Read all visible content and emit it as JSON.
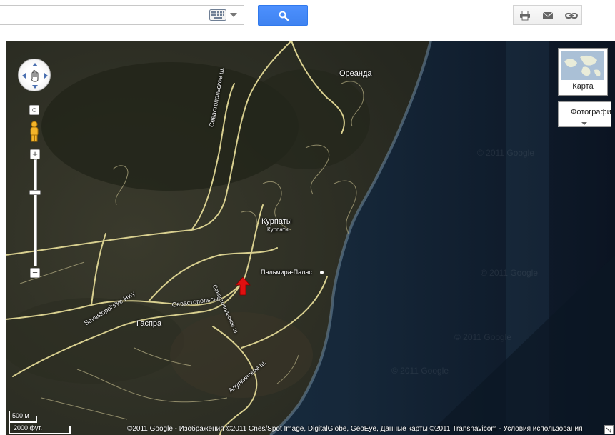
{
  "search": {
    "value": "",
    "placeholder": ""
  },
  "icons": {
    "keyboard": "keyboard-icon",
    "search": "search-icon",
    "print": "print-icon",
    "email": "email-icon",
    "link": "link-icon",
    "pan": "pan-arrows-icon",
    "pegman": "pegman-icon",
    "marker": "red-arrow-marker-icon"
  },
  "colors": {
    "search_button": "#4d90fe",
    "sea": "#15283a",
    "land": "#2f3125",
    "roads": "#d8cf8f",
    "marker": "#e01010"
  },
  "map": {
    "mode": "satellite",
    "labels": {
      "oreanda": "Ореанда",
      "kurpaty": "Курпаты",
      "kurpaty_small": "Курпати",
      "palmira": "Пальмира-Палас",
      "gaspra": "Гаспра",
      "sevastopol_road_north": "Севастопольское ш.",
      "sevastopol_road_center": "Севастопольское ш.",
      "sevastopol_road_mid": "Севастопольськ",
      "sevastopol_hwy": "Sevastopol's'ke Hwy",
      "alupka_road": "Алупкинское ш."
    },
    "watermark": "© 2011 Google"
  },
  "controls": {
    "zoom_in": "+",
    "zoom_out": "−",
    "map_type_label": "Карта",
    "photos_label": "Фотографии"
  },
  "scale": {
    "metric": "500 м",
    "imperial": "2000 фут."
  },
  "copyright": "©2011 Google - Изображения ©2011 Cnes/Spot Image, DigitalGlobe, GeoEye, Данные карты ©2011 Transnavicom - Условия использования"
}
